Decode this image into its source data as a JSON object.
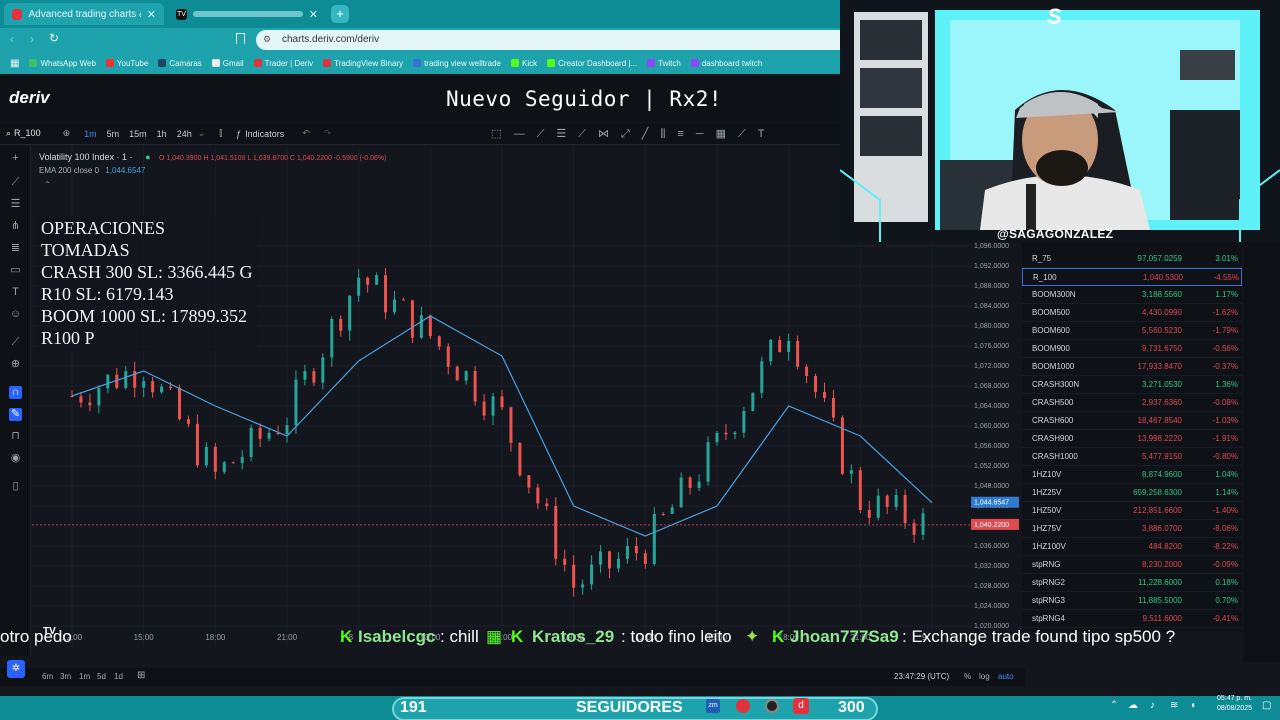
{
  "browser": {
    "tabs": [
      {
        "title": "Advanced trading charts & tool",
        "active": true
      },
      {
        "title": "",
        "active": false
      }
    ],
    "address": "charts.deriv.com/deriv",
    "bookmarks": [
      "WhatsApp Web",
      "YouTube",
      "Camaras",
      "Gmail",
      "Trader | Deriv",
      "TradingView Binary",
      "trading view welltrade",
      "Kick",
      "Creator Dashboard |...",
      "Twitch",
      "dashboard twitch"
    ]
  },
  "deriv": {
    "logo": "deriv",
    "overlay_title": "Nuevo Seguidor | Rx2!",
    "symbol": "R_100",
    "timeframes": [
      "1m",
      "5m",
      "15m",
      "1h",
      "24h"
    ],
    "indicators_label": "Indicators",
    "legend_title": "Volatility 100 Index · 1 ·",
    "ohlc": "O 1,040.3900  H 1,041.5100  L 1,039.8700  C 1,040.2200  -0.5900 (-0.06%)",
    "ema": "EMA 200 close 0",
    "ema_value": "1,044.6547",
    "current_price": "1,040.2200"
  },
  "operations": {
    "title": "OPERACIONES TOMADAS",
    "lines": [
      "CRASH 300 SL: 3366.445 G",
      "R10 SL: 6179.143",
      "BOOM 1000 SL: 17899.352",
      "R100 P"
    ]
  },
  "chart_data": {
    "type": "line",
    "title": "Volatility 100 Index",
    "x": [
      "12:00",
      "15:00",
      "18:00",
      "21:00",
      "8",
      "03:00",
      "06:00",
      "09:00",
      "12:00",
      "15:00",
      "18:00",
      "21:00",
      "9"
    ],
    "series": [
      {
        "name": "Volatility 100 Index · 1",
        "values": [
          1066,
          1072,
          1050,
          1062,
          1090,
          1078,
          1062,
          1028,
          1036,
          1056,
          1080,
          1045,
          1040
        ]
      },
      {
        "name": "EMA 200 close 0",
        "values": [
          1066,
          1071,
          1064,
          1058,
          1073,
          1082,
          1074,
          1044,
          1038,
          1044,
          1064,
          1058,
          1044.6547
        ]
      }
    ],
    "ylim": [
      1020,
      1096
    ],
    "yticks": [
      "1,096.0000",
      "1,092.0000",
      "1,088.0000",
      "1,084.0000",
      "1,080.0000",
      "1,076.0000",
      "1,072.0000",
      "1,068.0000",
      "1,064.0000",
      "1,060.0000",
      "1,056.0000",
      "1,052.0000",
      "1,048.0000",
      "1,044.0000",
      "1,040.0000",
      "1,036.0000",
      "1,032.0000",
      "1,028.0000",
      "1,024.0000",
      "1,020.0000"
    ],
    "last_price": "1,040.2200",
    "ema_last": "1,044.6547"
  },
  "time_axis_footer": {
    "time": "23:47:29 (UTC)",
    "options": [
      "%",
      "log",
      "auto"
    ],
    "ranges": [
      "6m",
      "3m",
      "1m",
      "5d",
      "1d"
    ]
  },
  "watchlist": [
    {
      "sym": "R_75",
      "price": "97,057.0259",
      "chg": "3.01%",
      "dir": "up"
    },
    {
      "sym": "R_100",
      "price": "1,040.5300",
      "chg": "-4.55%",
      "dir": "dn"
    },
    {
      "sym": "BOOM300N",
      "price": "3,188.5560",
      "chg": "1.17%",
      "dir": "up"
    },
    {
      "sym": "BOOM500",
      "price": "4,430.0990",
      "chg": "-1.62%",
      "dir": "dn"
    },
    {
      "sym": "BOOM600",
      "price": "5,560.5230",
      "chg": "-1.79%",
      "dir": "dn"
    },
    {
      "sym": "BOOM900",
      "price": "9,731.6750",
      "chg": "-0.56%",
      "dir": "dn"
    },
    {
      "sym": "BOOM1000",
      "price": "17,933.8470",
      "chg": "-0.37%",
      "dir": "dn"
    },
    {
      "sym": "CRASH300N",
      "price": "3,271.0530",
      "chg": "1.36%",
      "dir": "up"
    },
    {
      "sym": "CRASH500",
      "price": "2,937.6360",
      "chg": "-0.08%",
      "dir": "dn"
    },
    {
      "sym": "CRASH600",
      "price": "18,467.8540",
      "chg": "-1.03%",
      "dir": "dn"
    },
    {
      "sym": "CRASH900",
      "price": "13,998.2220",
      "chg": "-1.91%",
      "dir": "dn"
    },
    {
      "sym": "CRASH1000",
      "price": "5,477.9150",
      "chg": "-0.80%",
      "dir": "dn"
    },
    {
      "sym": "1HZ10V",
      "price": "8,874.9600",
      "chg": "1.04%",
      "dir": "up"
    },
    {
      "sym": "1HZ25V",
      "price": "659,258.6300",
      "chg": "1.14%",
      "dir": "up"
    },
    {
      "sym": "1HZ50V",
      "price": "212,851.6600",
      "chg": "-1.40%",
      "dir": "dn"
    },
    {
      "sym": "1HZ75V",
      "price": "3,886.0700",
      "chg": "-8.06%",
      "dir": "dn"
    },
    {
      "sym": "1HZ100V",
      "price": "484.8200",
      "chg": "-8.22%",
      "dir": "dn"
    },
    {
      "sym": "stpRNG",
      "price": "8,230.2000",
      "chg": "-0.09%",
      "dir": "dn"
    },
    {
      "sym": "stpRNG2",
      "price": "11,228.6000",
      "chg": "0.18%",
      "dir": "up"
    },
    {
      "sym": "stpRNG3",
      "price": "11,885.5000",
      "chg": "0.70%",
      "dir": "up"
    },
    {
      "sym": "stpRNG4",
      "price": "9,511.6000",
      "chg": "-0.41%",
      "dir": "dn"
    }
  ],
  "webcam": {
    "handle": "@SAGAGONZALEZ"
  },
  "chat_ticker": [
    {
      "user": "",
      "msg": "otro pedo"
    },
    {
      "user": "Isabelcgc",
      "msg": ": chill"
    },
    {
      "user": "Kratos_29",
      "msg": ": todo fino leito"
    },
    {
      "user": "Jhoan777Sa9",
      "msg": ": Exchange trade found tipo sp500 ?"
    }
  ],
  "followers": {
    "current": "191",
    "label": "SEGUIDORES",
    "goal": "300"
  },
  "clock": {
    "time": "05:47 p. m.",
    "date": "08/08/2025"
  }
}
